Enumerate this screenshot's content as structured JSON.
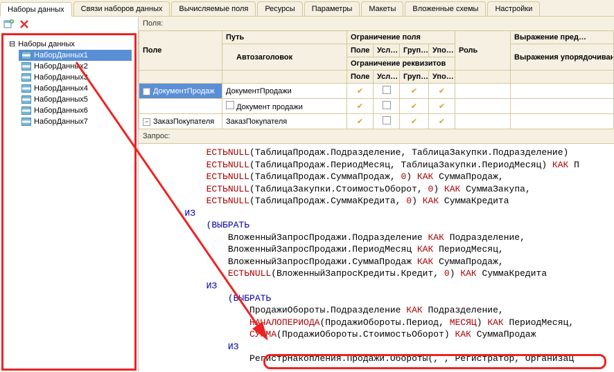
{
  "tabs": [
    "Наборы данных",
    "Связи наборов данных",
    "Вычисляемые поля",
    "Ресурсы",
    "Параметры",
    "Макеты",
    "Вложенные схемы",
    "Настройки"
  ],
  "activeTab": 0,
  "tree": {
    "root": "Наборы данных",
    "items": [
      "НаборДанных1",
      "НаборДанных2",
      "НаборДанных3",
      "НаборДанных4",
      "НаборДанных5",
      "НаборДанных6",
      "НаборДанных7"
    ]
  },
  "fieldsLabel": "Поля:",
  "queryLabel": "Запрос:",
  "headers": {
    "field": "Поле",
    "path": "Путь",
    "autotitle": "Автозаголовок",
    "restrField": "Ограничение поля",
    "restrReq": "Ограничение реквизитов",
    "role": "Роль",
    "expr": "Выражение пред…",
    "orderExpr": "Выражения упорядочивания",
    "short": {
      "pole": "Поле",
      "usl": "Усл…",
      "grup": "Груп…",
      "upo": "Упо…"
    }
  },
  "rows": [
    {
      "field": "ДокументПродаж",
      "path": "ДокументПродажи",
      "checks": [
        true,
        false,
        true,
        true
      ],
      "kind": "group"
    },
    {
      "field": "",
      "path": "Документ продажи",
      "checks": [
        true,
        false,
        true,
        true
      ],
      "kind": "child"
    },
    {
      "field": "ЗаказПокупателя",
      "path": "ЗаказПокупателя",
      "checks": [
        true,
        false,
        true,
        true
      ],
      "kind": "group"
    }
  ],
  "query": {
    "l01a": "ЕСТЬNULL",
    "l01b": "(ТаблицаПродаж.Подразделение, ТаблицаЗакупки.Подразделение) ",
    "l02a": "ЕСТЬNULL",
    "l02b": "(ТаблицаПродаж.ПериодМесяц, ТаблицаЗакупки.ПериодМесяц) ",
    "l02kak": "КАК",
    "l02c": " П",
    "l03a": "ЕСТЬNULL",
    "l03b": "(ТаблицаПродаж.СуммаПродаж, ",
    "l03n": "0",
    "l03c": ") ",
    "l03kak": "КАК",
    "l03d": " СуммаПродаж,",
    "l04a": "ЕСТЬNULL",
    "l04b": "(ТаблицаЗакупки.СтоимостьОборот, ",
    "l04n": "0",
    "l04c": ") ",
    "l04kak": "КАК",
    "l04d": " СуммаЗакупа,",
    "l05a": "ЕСТЬNULL",
    "l05b": "(ТаблицаПродаж.СуммаКредита, ",
    "l05n": "0",
    "l05c": ") ",
    "l05kak": "КАК",
    "l05d": " СуммаКредита",
    "iz": "ИЗ",
    "sel": "(ВЫБРАТЬ",
    "l07": "ВложенныйЗапросПродажи.Подразделение ",
    "l07kak": "КАК",
    "l07b": " Подразделение,",
    "l08": "ВложенныйЗапросПродажи.ПериодМесяц ",
    "l08kak": "КАК",
    "l08b": " ПериодМесяц,",
    "l09": "ВложенныйЗапросПродажи.СуммаПродаж ",
    "l09kak": "КАК",
    "l09b": " СуммаПродаж,",
    "l10a": "ЕСТЬNULL",
    "l10b": "(ВложенныйЗапросКредиты.Кредит, ",
    "l10n": "0",
    "l10c": ") ",
    "l10kak": "КАК",
    "l10d": " СуммаКредита",
    "l12": "ПродажиОбороты.Подразделение ",
    "l12kak": "КАК",
    "l12b": " Подразделение,",
    "l13a": "НАЧАЛОПЕРИОДА",
    "l13b": "(ПродажиОбороты.Период, ",
    "l13m": "МЕСЯЦ",
    "l13c": ") ",
    "l13kak": "КАК",
    "l13d": " ПериодМесяц,",
    "l14a": "СУММА",
    "l14b": "(ПродажиОбороты.СтоимостьОборот) ",
    "l14kak": "КАК",
    "l14d": " СуммаПродаж",
    "l15": "РегистрНакопления.Продажи.Обороты(, , Регистратор, Организац"
  }
}
